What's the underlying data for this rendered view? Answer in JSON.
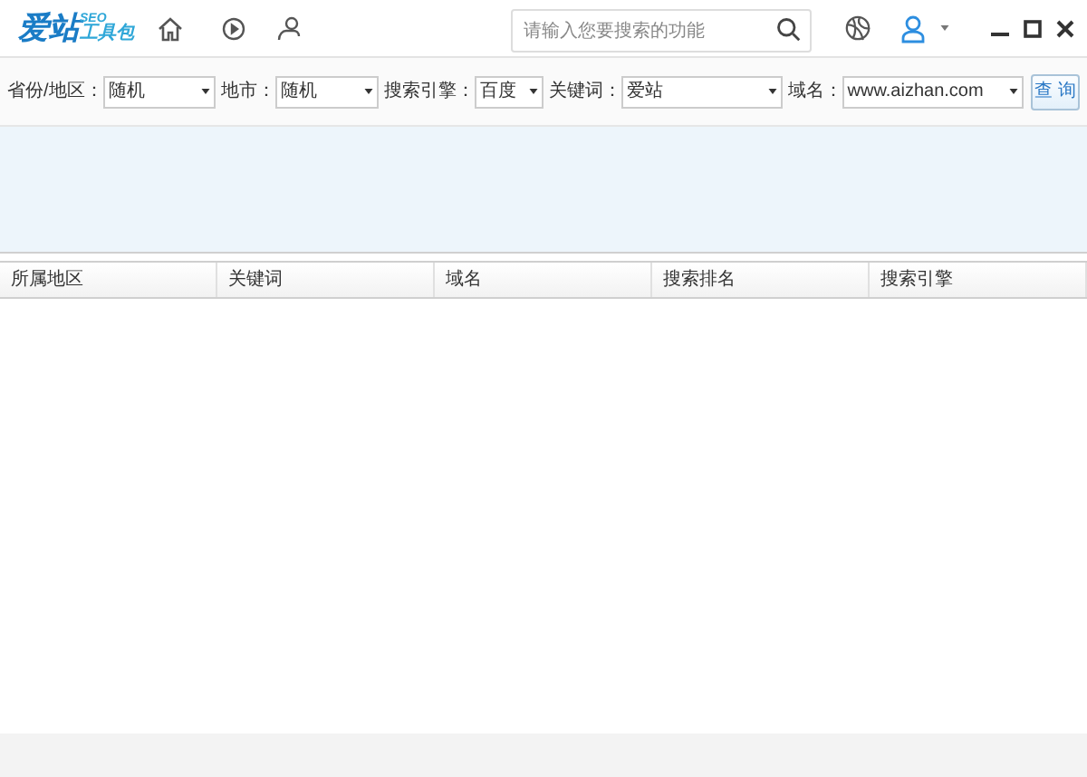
{
  "logo": {
    "main": "爱站",
    "badge": "SEO",
    "sub": "工具包"
  },
  "search": {
    "placeholder": "请输入您要搜索的功能"
  },
  "filters": [
    {
      "label": "省份/地区：",
      "value": "随机"
    },
    {
      "label": "地市：",
      "value": "随机"
    },
    {
      "label": "搜索引擎：",
      "value": "百度"
    },
    {
      "label": "关键词：",
      "value": "爱站"
    },
    {
      "label": "域名：",
      "value": "www.aizhan.com"
    }
  ],
  "query_button": "查 询",
  "table": {
    "columns": [
      "所属地区",
      "关键词",
      "域名",
      "搜索排名",
      "搜索引擎"
    ]
  }
}
